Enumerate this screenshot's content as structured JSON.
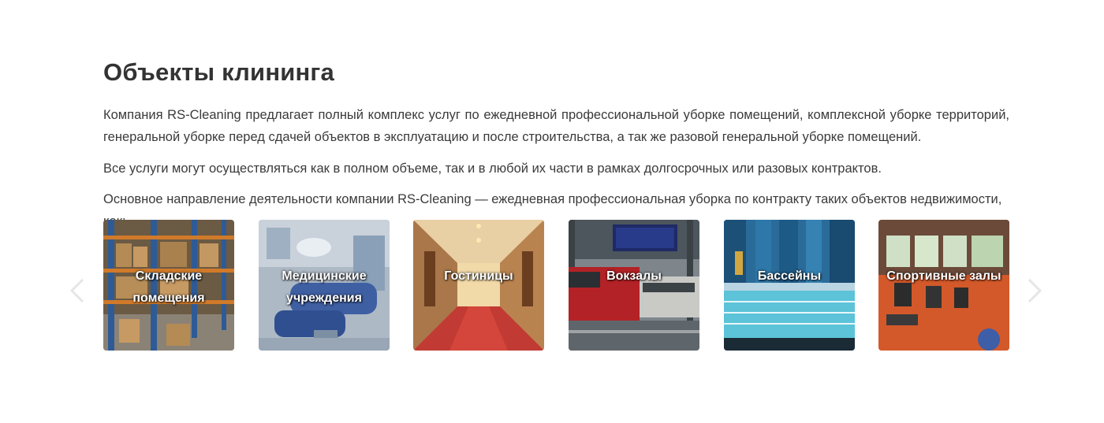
{
  "section": {
    "title": "Объекты клининга",
    "paragraphs": [
      "Компания RS-Cleaning предлагает полный комплекс услуг по ежедневной профессиональной уборке помещений, комплексной уборке территорий, генеральной уборке перед сдачей объектов в эксплуатацию и после строительства, а так же разовой генеральной уборке помещений.",
      "Все услуги могут осуществляться как в полном объеме, так и в любой их части в рамках долгосрочных или разовых контрактов.",
      "Основное направление деятельности компании RS-Cleaning — ежедневная профессиональная уборка по контракту таких объектов недвижимости, как:"
    ]
  },
  "carousel": {
    "items": [
      {
        "label": "Складские помещения"
      },
      {
        "label": "Медицинские учреждения"
      },
      {
        "label": "Гостиницы"
      },
      {
        "label": "Вокзалы"
      },
      {
        "label": "Бассейны"
      },
      {
        "label": "Спортивные залы"
      }
    ]
  },
  "icons": {
    "prev": "chevron-left-icon",
    "next": "chevron-right-icon"
  }
}
